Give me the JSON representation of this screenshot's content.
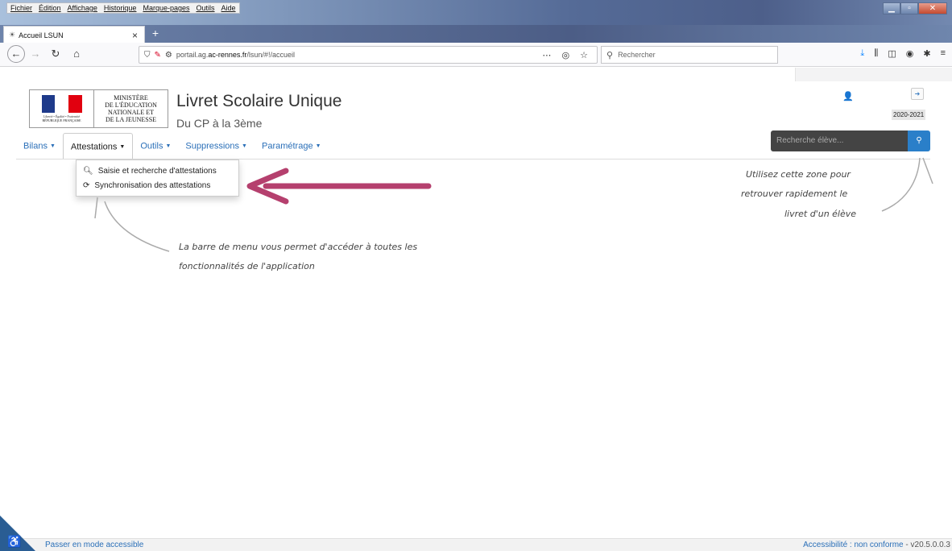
{
  "browser": {
    "menu": [
      "Fichier",
      "Édition",
      "Affichage",
      "Historique",
      "Marque-pages",
      "Outils",
      "Aide"
    ],
    "tab_title": "Accueil LSUN",
    "url_prefix": "portail.ag.",
    "url_domain": "ac-rennes.fr",
    "url_path": "/lsun/#!/accueil",
    "search_placeholder": "Rechercher"
  },
  "header": {
    "ministry_lines": [
      "MINISTÈRE",
      "DE L'ÉDUCATION",
      "NATIONALE ET",
      "DE LA JEUNESSE"
    ],
    "logo_motto": "Liberté • Égalité • Fraternité",
    "logo_rep": "RÉPUBLIQUE FRANÇAISE",
    "title": "Livret Scolaire Unique",
    "subtitle": "Du CP à la 3ème",
    "year": "2020-2021",
    "student_search_placeholder": "Recherche élève..."
  },
  "nav": {
    "items": [
      {
        "label": "Bilans",
        "active": false
      },
      {
        "label": "Attestations",
        "active": true
      },
      {
        "label": "Outils",
        "active": false
      },
      {
        "label": "Suppressions",
        "active": false
      },
      {
        "label": "Paramétrage",
        "active": false
      }
    ]
  },
  "dropdown": {
    "items": [
      {
        "icon": "search-icon",
        "label": "Saisie et recherche d'attestations"
      },
      {
        "icon": "refresh-icon",
        "label": "Synchronisation des attestations"
      }
    ]
  },
  "annotations": {
    "search_hint": [
      "Utilisez cette zone pour",
      "retrouver rapidement le",
      "livret d'un élève"
    ],
    "menu_hint": [
      "La barre de menu vous permet d'accéder à toutes les",
      "fonctionnalités de l'application"
    ]
  },
  "colors": {
    "accent": "#2a6fb8",
    "annotation_arrow": "#b5406e"
  },
  "footer": {
    "accessible_mode": "Passer en mode accessible",
    "accessibility_status": "Accessibilité : non conforme",
    "version": " - v20.5.0.0.3"
  }
}
